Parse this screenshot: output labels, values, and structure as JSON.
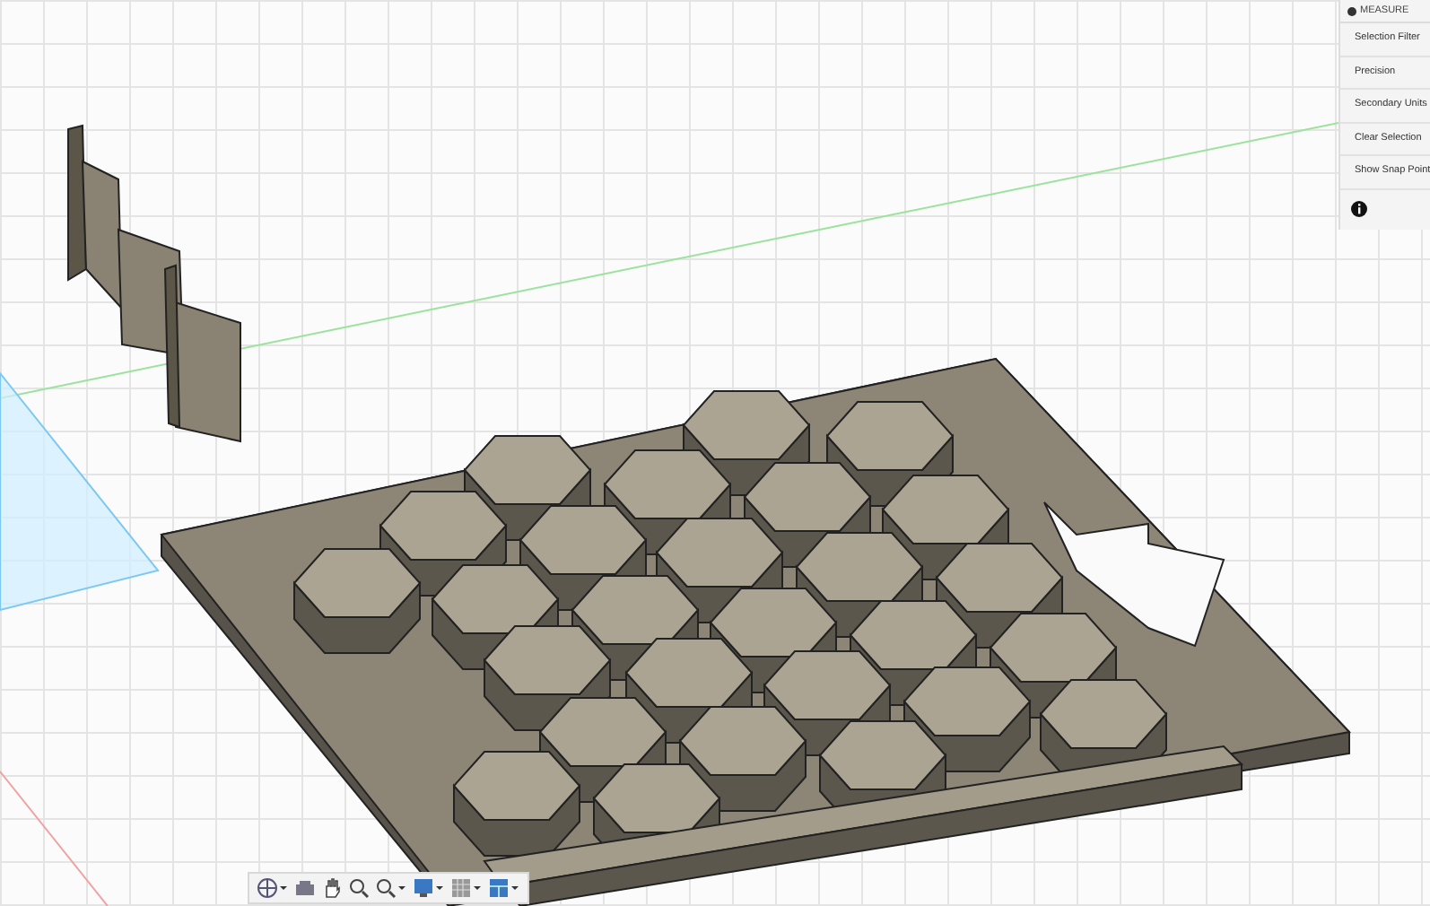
{
  "measure_panel": {
    "title": "MEASURE",
    "items": [
      {
        "label": "Selection Filter"
      },
      {
        "label": "Precision"
      },
      {
        "label": "Secondary Units"
      },
      {
        "label": "Clear Selection"
      },
      {
        "label": "Show Snap Point"
      }
    ]
  }
}
